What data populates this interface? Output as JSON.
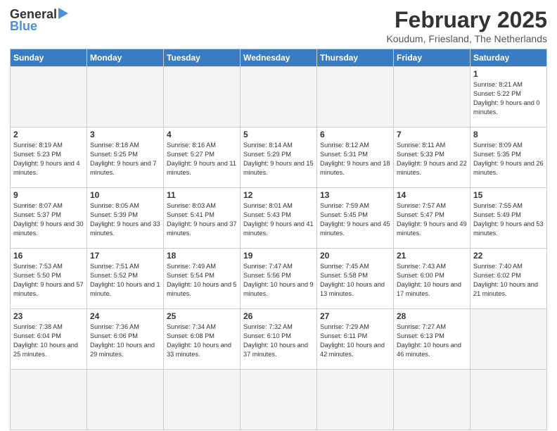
{
  "logo": {
    "general": "General",
    "blue": "Blue",
    "arrow": "▶"
  },
  "header": {
    "month_year": "February 2025",
    "location": "Koudum, Friesland, The Netherlands"
  },
  "weekdays": [
    "Sunday",
    "Monday",
    "Tuesday",
    "Wednesday",
    "Thursday",
    "Friday",
    "Saturday"
  ],
  "days": [
    {
      "num": "",
      "info": ""
    },
    {
      "num": "",
      "info": ""
    },
    {
      "num": "",
      "info": ""
    },
    {
      "num": "",
      "info": ""
    },
    {
      "num": "",
      "info": ""
    },
    {
      "num": "",
      "info": ""
    },
    {
      "num": "1",
      "info": "Sunrise: 8:21 AM\nSunset: 5:22 PM\nDaylight: 9 hours and 0 minutes."
    },
    {
      "num": "2",
      "info": "Sunrise: 8:19 AM\nSunset: 5:23 PM\nDaylight: 9 hours and 4 minutes."
    },
    {
      "num": "3",
      "info": "Sunrise: 8:18 AM\nSunset: 5:25 PM\nDaylight: 9 hours and 7 minutes."
    },
    {
      "num": "4",
      "info": "Sunrise: 8:16 AM\nSunset: 5:27 PM\nDaylight: 9 hours and 11 minutes."
    },
    {
      "num": "5",
      "info": "Sunrise: 8:14 AM\nSunset: 5:29 PM\nDaylight: 9 hours and 15 minutes."
    },
    {
      "num": "6",
      "info": "Sunrise: 8:12 AM\nSunset: 5:31 PM\nDaylight: 9 hours and 18 minutes."
    },
    {
      "num": "7",
      "info": "Sunrise: 8:11 AM\nSunset: 5:33 PM\nDaylight: 9 hours and 22 minutes."
    },
    {
      "num": "8",
      "info": "Sunrise: 8:09 AM\nSunset: 5:35 PM\nDaylight: 9 hours and 26 minutes."
    },
    {
      "num": "9",
      "info": "Sunrise: 8:07 AM\nSunset: 5:37 PM\nDaylight: 9 hours and 30 minutes."
    },
    {
      "num": "10",
      "info": "Sunrise: 8:05 AM\nSunset: 5:39 PM\nDaylight: 9 hours and 33 minutes."
    },
    {
      "num": "11",
      "info": "Sunrise: 8:03 AM\nSunset: 5:41 PM\nDaylight: 9 hours and 37 minutes."
    },
    {
      "num": "12",
      "info": "Sunrise: 8:01 AM\nSunset: 5:43 PM\nDaylight: 9 hours and 41 minutes."
    },
    {
      "num": "13",
      "info": "Sunrise: 7:59 AM\nSunset: 5:45 PM\nDaylight: 9 hours and 45 minutes."
    },
    {
      "num": "14",
      "info": "Sunrise: 7:57 AM\nSunset: 5:47 PM\nDaylight: 9 hours and 49 minutes."
    },
    {
      "num": "15",
      "info": "Sunrise: 7:55 AM\nSunset: 5:49 PM\nDaylight: 9 hours and 53 minutes."
    },
    {
      "num": "16",
      "info": "Sunrise: 7:53 AM\nSunset: 5:50 PM\nDaylight: 9 hours and 57 minutes."
    },
    {
      "num": "17",
      "info": "Sunrise: 7:51 AM\nSunset: 5:52 PM\nDaylight: 10 hours and 1 minute."
    },
    {
      "num": "18",
      "info": "Sunrise: 7:49 AM\nSunset: 5:54 PM\nDaylight: 10 hours and 5 minutes."
    },
    {
      "num": "19",
      "info": "Sunrise: 7:47 AM\nSunset: 5:56 PM\nDaylight: 10 hours and 9 minutes."
    },
    {
      "num": "20",
      "info": "Sunrise: 7:45 AM\nSunset: 5:58 PM\nDaylight: 10 hours and 13 minutes."
    },
    {
      "num": "21",
      "info": "Sunrise: 7:43 AM\nSunset: 6:00 PM\nDaylight: 10 hours and 17 minutes."
    },
    {
      "num": "22",
      "info": "Sunrise: 7:40 AM\nSunset: 6:02 PM\nDaylight: 10 hours and 21 minutes."
    },
    {
      "num": "23",
      "info": "Sunrise: 7:38 AM\nSunset: 6:04 PM\nDaylight: 10 hours and 25 minutes."
    },
    {
      "num": "24",
      "info": "Sunrise: 7:36 AM\nSunset: 6:06 PM\nDaylight: 10 hours and 29 minutes."
    },
    {
      "num": "25",
      "info": "Sunrise: 7:34 AM\nSunset: 6:08 PM\nDaylight: 10 hours and 33 minutes."
    },
    {
      "num": "26",
      "info": "Sunrise: 7:32 AM\nSunset: 6:10 PM\nDaylight: 10 hours and 37 minutes."
    },
    {
      "num": "27",
      "info": "Sunrise: 7:29 AM\nSunset: 6:11 PM\nDaylight: 10 hours and 42 minutes."
    },
    {
      "num": "28",
      "info": "Sunrise: 7:27 AM\nSunset: 6:13 PM\nDaylight: 10 hours and 46 minutes."
    },
    {
      "num": "",
      "info": ""
    },
    {
      "num": "",
      "info": ""
    },
    {
      "num": "",
      "info": ""
    },
    {
      "num": "",
      "info": ""
    },
    {
      "num": "",
      "info": ""
    },
    {
      "num": "",
      "info": ""
    },
    {
      "num": "",
      "info": ""
    },
    {
      "num": "",
      "info": ""
    }
  ]
}
